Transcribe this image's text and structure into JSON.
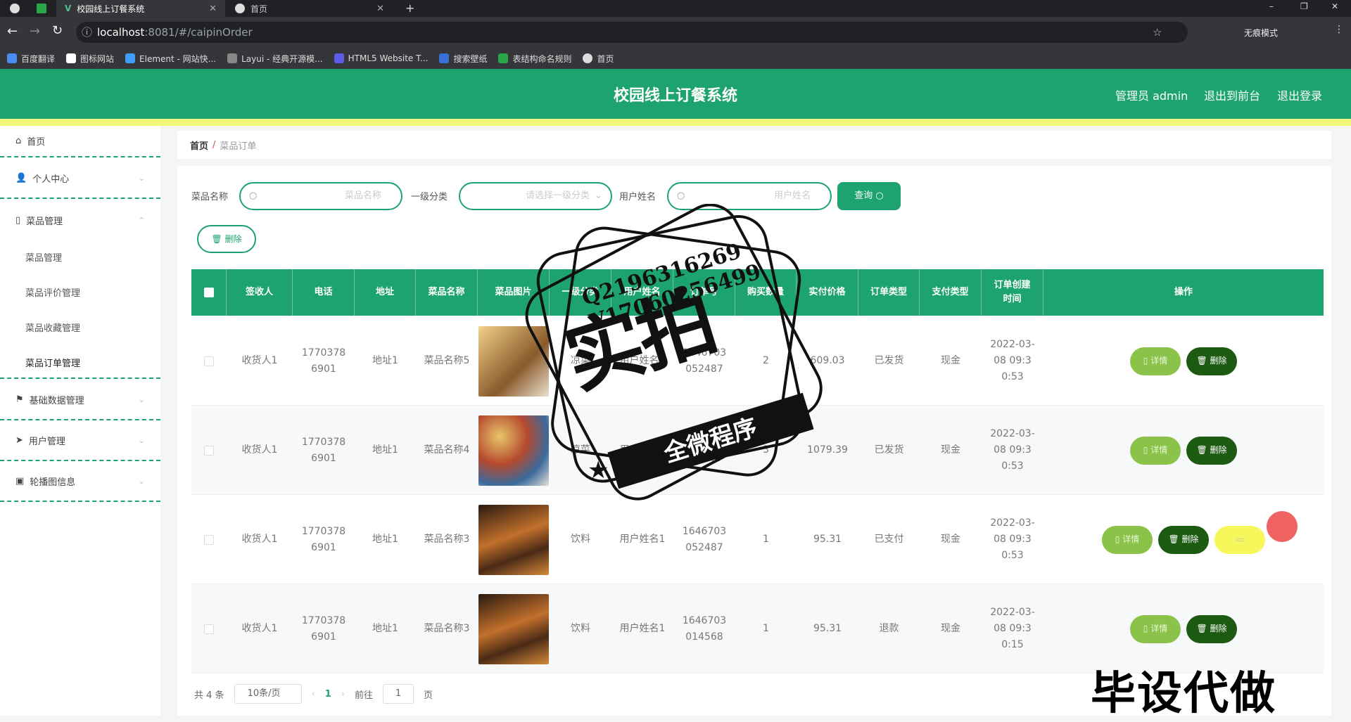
{
  "browser": {
    "tabs": [
      {
        "title": "校园线上订餐系统",
        "close": "✕"
      },
      {
        "title": "首页",
        "close": "✕"
      }
    ],
    "new_tab": "+",
    "url_host": "localhost",
    "url_rest": ":8081/#/caipinOrder",
    "incognito": "无痕模式",
    "bookmarks": [
      "百度翻译",
      "图标网站",
      "Element - 网站快...",
      "Layui - 经典开源模...",
      "HTML5 Website T...",
      "搜索壁纸",
      "表结构命名规则",
      "首页"
    ]
  },
  "header": {
    "title": "校园线上订餐系统",
    "admin": "管理员 admin",
    "to_front": "退出到前台",
    "logout": "退出登录"
  },
  "sidebar": {
    "home": "首页",
    "personal": "个人中心",
    "dish_mgmt": "菜品管理",
    "sub_items": [
      "菜品管理",
      "菜品评价管理",
      "菜品收藏管理",
      "菜品订单管理"
    ],
    "basic_data": "基础数据管理",
    "user_mgmt": "用户管理",
    "carousel": "轮播图信息"
  },
  "breadcrumb": {
    "home": "首页",
    "sep": "/",
    "current": "菜品订单"
  },
  "filters": {
    "dish_name_label": "菜品名称",
    "dish_name_placeholder": "菜品名称",
    "category_label": "一级分类",
    "category_placeholder": "请选择一级分类",
    "user_label": "用户姓名",
    "user_placeholder": "用户姓名",
    "query_button": "查询",
    "delete_button": "删除"
  },
  "table": {
    "headers": [
      "签收人",
      "电话",
      "地址",
      "菜品名称",
      "菜品图片",
      "一级分类",
      "用户姓名",
      "订单号",
      "购买数量",
      "实付价格",
      "订单类型",
      "支付类型",
      "订单创建时间",
      "操作"
    ],
    "rows": [
      {
        "receiver": "收货人1",
        "phone": "17703786901",
        "address": "地址1",
        "dish": "菜品名称5",
        "category": "凉菜",
        "user": "用户姓名1",
        "order_no": "1646703052487",
        "qty": "2",
        "price": "609.03",
        "order_type": "已发货",
        "pay_type": "现金",
        "created": "2022-03-08 09:30:53"
      },
      {
        "receiver": "收货人1",
        "phone": "17703786901",
        "address": "地址1",
        "dish": "菜品名称4",
        "category": "凉菜",
        "user": "用户姓名1",
        "order_no": "1646703052487",
        "qty": "3",
        "price": "1079.39",
        "order_type": "已发货",
        "pay_type": "现金",
        "created": "2022-03-08 09:30:53"
      },
      {
        "receiver": "收货人1",
        "phone": "17703786901",
        "address": "地址1",
        "dish": "菜品名称3",
        "category": "饮料",
        "user": "用户姓名1",
        "order_no": "1646703052487",
        "qty": "1",
        "price": "95.31",
        "order_type": "已支付",
        "pay_type": "现金",
        "created": "2022-03-08 09:30:53"
      },
      {
        "receiver": "收货人1",
        "phone": "17703786901",
        "address": "地址1",
        "dish": "菜品名称3",
        "category": "饮料",
        "user": "用户姓名1",
        "order_no": "1646703014568",
        "qty": "1",
        "price": "95.31",
        "order_type": "退款",
        "pay_type": "现金",
        "created": "2022-03-08 09:30:15"
      }
    ],
    "detail_button": "详情",
    "delete_button": "删除"
  },
  "pagination": {
    "total": "共 4 条",
    "page_size": "10条/页",
    "current_page": "1",
    "goto_label": "前往",
    "goto_value": "1",
    "page_suffix": "页"
  },
  "watermark": {
    "contact_qq": "Q2196316269",
    "contact_v": "V17060256499",
    "big": "实拍",
    "ribbon": "全微程序",
    "corner": "毕设代做"
  },
  "colors": {
    "primary": "#1ca36f",
    "stripe": "#f4f777",
    "detail": "#8bc34a",
    "delete": "#1d5a12"
  }
}
